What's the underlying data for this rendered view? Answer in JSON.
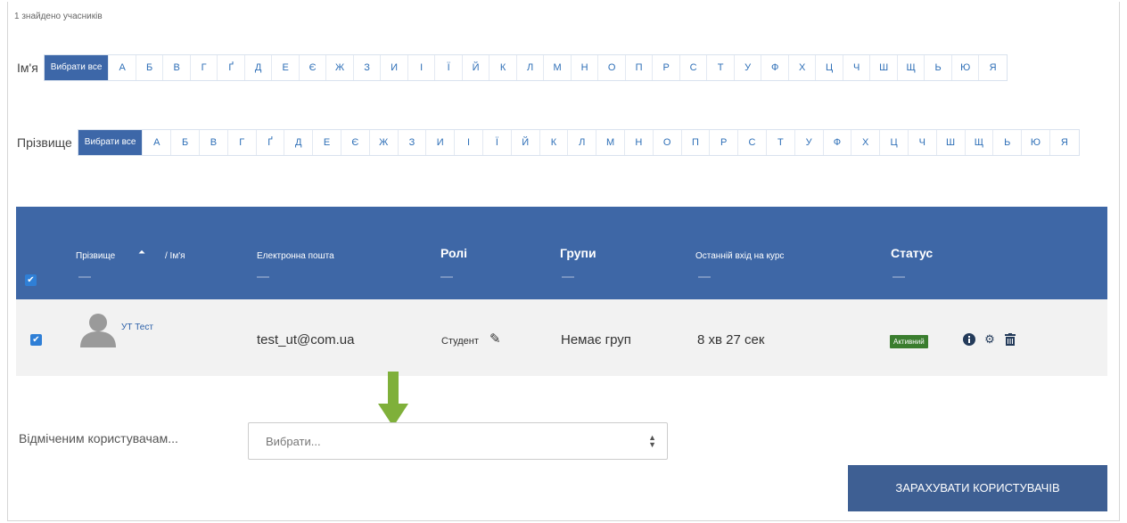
{
  "participants_count": "1 знайдено учасників",
  "filter_firstname": {
    "label": "Ім'я",
    "all_label": "Вибрати все",
    "letters": [
      "А",
      "Б",
      "В",
      "Г",
      "Ґ",
      "Д",
      "Е",
      "Є",
      "Ж",
      "З",
      "И",
      "І",
      "Ї",
      "Й",
      "К",
      "Л",
      "М",
      "Н",
      "О",
      "П",
      "Р",
      "С",
      "Т",
      "У",
      "Ф",
      "Х",
      "Ц",
      "Ч",
      "Ш",
      "Щ",
      "Ь",
      "Ю",
      "Я"
    ]
  },
  "filter_lastname": {
    "label": "Прізвище",
    "all_label": "Вибрати все",
    "letters": [
      "А",
      "Б",
      "В",
      "Г",
      "Ґ",
      "Д",
      "Е",
      "Є",
      "Ж",
      "З",
      "И",
      "І",
      "Ї",
      "Й",
      "К",
      "Л",
      "М",
      "Н",
      "О",
      "П",
      "Р",
      "С",
      "Т",
      "У",
      "Ф",
      "Х",
      "Ц",
      "Ч",
      "Ш",
      "Щ",
      "Ь",
      "Ю",
      "Я"
    ]
  },
  "table": {
    "headers": {
      "lastname": "Прізвище",
      "firstname": "/ Ім'я",
      "email": "Електронна пошта",
      "roles": "Ролі",
      "groups": "Групи",
      "last_access": "Останній вхід на курс",
      "status": "Статус"
    },
    "rows": [
      {
        "name": "УТ Тест",
        "email": "test_ut@com.ua",
        "role": "Студент",
        "groups": "Немає груп",
        "last_access": "8 хв 27 сек",
        "status": "Активний"
      }
    ]
  },
  "bulk": {
    "label": "Відміченим користувачам...",
    "select_value": "Вибрати..."
  },
  "enrol_button": "ЗАРАХУВАТИ КОРИСТУВАЧІВ",
  "colors": {
    "header_bg": "#3e67a6",
    "accent": "#2e6fb7",
    "status_active": "#3a7d2e",
    "arrow": "#7fb03a"
  }
}
